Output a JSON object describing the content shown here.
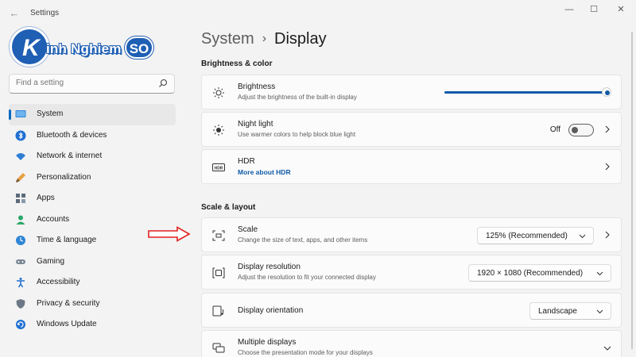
{
  "window": {
    "title": "Settings",
    "back": "←",
    "minimize": "—",
    "maximize": "☐",
    "close": "✕"
  },
  "logo": {
    "letter": "K",
    "text": "inh Nghiem",
    "badge": "SO",
    "brand_color": "#1f5fb4"
  },
  "search": {
    "placeholder": "Find a setting",
    "icon": "search-icon"
  },
  "sidebar": {
    "items": [
      {
        "label": "System",
        "icon": "monitor-icon",
        "active": true
      },
      {
        "label": "Bluetooth & devices",
        "icon": "bluetooth-icon"
      },
      {
        "label": "Network & internet",
        "icon": "wifi-icon"
      },
      {
        "label": "Personalization",
        "icon": "brush-icon"
      },
      {
        "label": "Apps",
        "icon": "apps-icon"
      },
      {
        "label": "Accounts",
        "icon": "person-icon"
      },
      {
        "label": "Time & language",
        "icon": "globe-clock-icon"
      },
      {
        "label": "Gaming",
        "icon": "gamepad-icon"
      },
      {
        "label": "Accessibility",
        "icon": "accessibility-icon"
      },
      {
        "label": "Privacy & security",
        "icon": "shield-icon"
      },
      {
        "label": "Windows Update",
        "icon": "update-icon"
      }
    ]
  },
  "header": {
    "parent": "System",
    "separator": "›",
    "current": "Display"
  },
  "sections": {
    "brightness_color": "Brightness & color",
    "scale_layout": "Scale & layout"
  },
  "brightness": {
    "title": "Brightness",
    "subtitle": "Adjust the brightness of the built-in display",
    "value_percent": 100
  },
  "night_light": {
    "title": "Night light",
    "subtitle": "Use warmer colors to help block blue light",
    "state": "Off"
  },
  "hdr": {
    "title": "HDR",
    "link": "More about HDR"
  },
  "scale": {
    "title": "Scale",
    "subtitle": "Change the size of text, apps, and other items",
    "value": "125% (Recommended)"
  },
  "resolution": {
    "title": "Display resolution",
    "subtitle": "Adjust the resolution to fit your connected display",
    "value": "1920 × 1080 (Recommended)"
  },
  "orientation": {
    "title": "Display orientation",
    "value": "Landscape"
  },
  "multiple_displays": {
    "title": "Multiple displays",
    "subtitle": "Choose the presentation mode for your displays"
  },
  "colors": {
    "accent": "#0f5aa8",
    "background": "#f3f3f3",
    "card": "#fbfbfb",
    "annotation_arrow": "#e02020"
  }
}
